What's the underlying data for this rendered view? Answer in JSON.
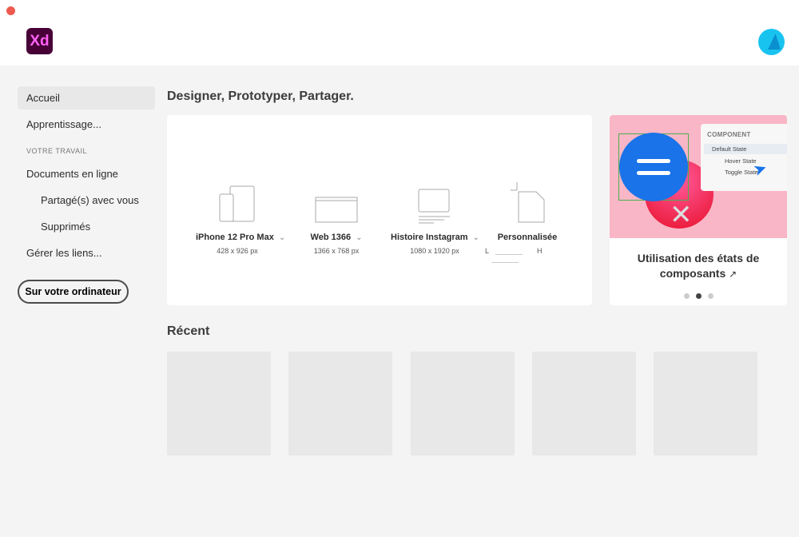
{
  "app": {
    "logo": "Xd"
  },
  "sidebar": {
    "items": [
      {
        "label": "Accueil"
      },
      {
        "label": "Apprentissage..."
      }
    ],
    "section": "VOTRE TRAVAIL",
    "work": [
      {
        "label": "Documents en ligne"
      },
      {
        "label": "Partagé(s) avec vous"
      },
      {
        "label": "Supprimés"
      },
      {
        "label": "Gérer les liens..."
      }
    ],
    "local_button": "Sur votre ordinateur"
  },
  "main": {
    "title": "Designer, Prototyper, Partager.",
    "presets": [
      {
        "name": "iPhone 12 Pro Max",
        "size": "428 x 926 px"
      },
      {
        "name": "Web 1366",
        "size": "1366 x 768 px"
      },
      {
        "name": "Histoire Instagram",
        "size": "1080 x 1920 px"
      },
      {
        "name": "Personnalisée",
        "w_label": "L",
        "h_label": "H"
      }
    ],
    "card": {
      "title": "Utilisation des états de composants",
      "panel_header": "COMPONENT",
      "states": [
        "Default State",
        "Hover State",
        "Toggle State"
      ],
      "page": 2,
      "pages": 3
    },
    "recent_title": "Récent"
  }
}
